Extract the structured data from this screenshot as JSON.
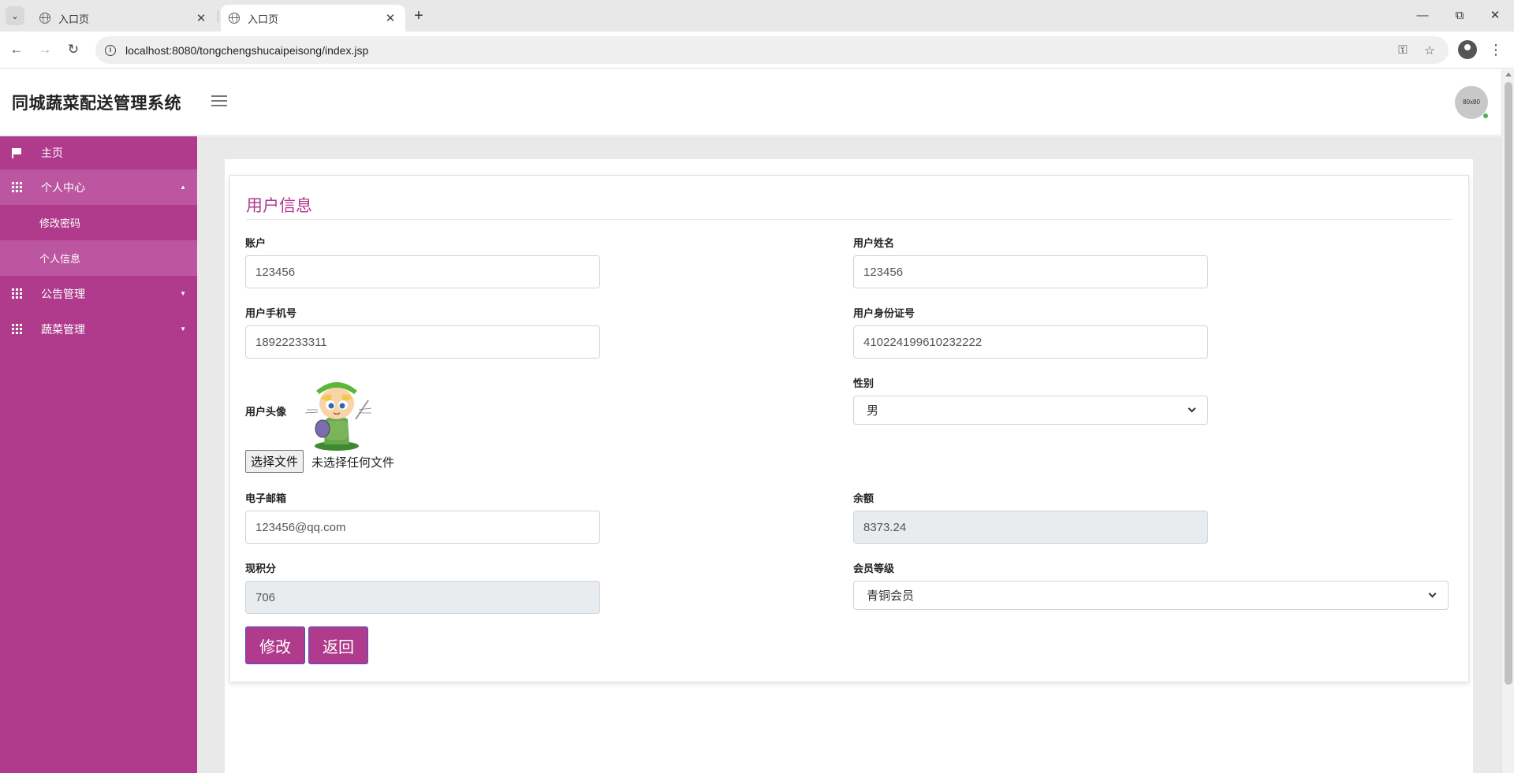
{
  "browser": {
    "tabs": [
      {
        "title": "入口页",
        "active": false
      },
      {
        "title": "入口页",
        "active": true
      }
    ],
    "url": "localhost:8080/tongchengshucaipeisong/index.jsp"
  },
  "header": {
    "title": "同城蔬菜配送管理系统",
    "avatar_text": "80x80"
  },
  "sidebar": {
    "home": "主页",
    "personal_center": "个人中心",
    "change_password": "修改密码",
    "personal_info": "个人信息",
    "notice_mgmt": "公告管理",
    "vegetable_mgmt": "蔬菜管理"
  },
  "form": {
    "title": "用户信息",
    "account_label": "账户",
    "account_value": "123456",
    "username_label": "用户姓名",
    "username_value": "123456",
    "phone_label": "用户手机号",
    "phone_value": "18922233311",
    "idcard_label": "用户身份证号",
    "idcard_value": "410224199610232222",
    "avatar_label": "用户头像",
    "choose_file": "选择文件",
    "no_file": "未选择任何文件",
    "gender_label": "性别",
    "gender_value": "男",
    "email_label": "电子邮箱",
    "email_value": "123456@qq.com",
    "balance_label": "余额",
    "balance_value": "8373.24",
    "points_label": "现积分",
    "points_value": "706",
    "level_label": "会员等级",
    "level_value": "青铜会员",
    "submit_label": "修改",
    "back_label": "返回"
  },
  "colors": {
    "accent": "#b03b8c",
    "sidebar_highlight": "#bd56a0"
  }
}
